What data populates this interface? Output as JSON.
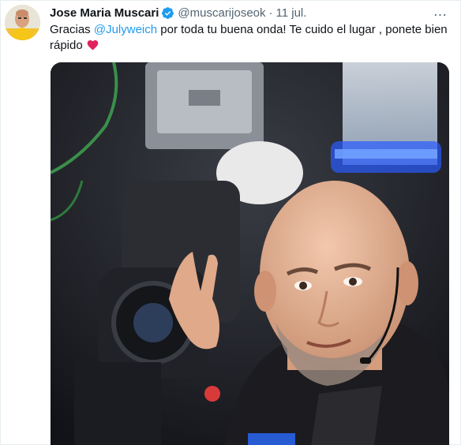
{
  "tweet": {
    "display_name": "Jose Maria Muscari",
    "verified": true,
    "handle": "@muscarijoseok",
    "separator": "·",
    "date": "11 jul.",
    "text_before": "Gracias ",
    "mention": "@Julyweich",
    "text_after": " por toda tu buena onda! Te cuido el lugar , ponete bien rápido",
    "more_icon": "…",
    "heart_color": "#e0245e",
    "verified_color": "#1d9bf0",
    "mention_color": "#1d9bf0"
  }
}
